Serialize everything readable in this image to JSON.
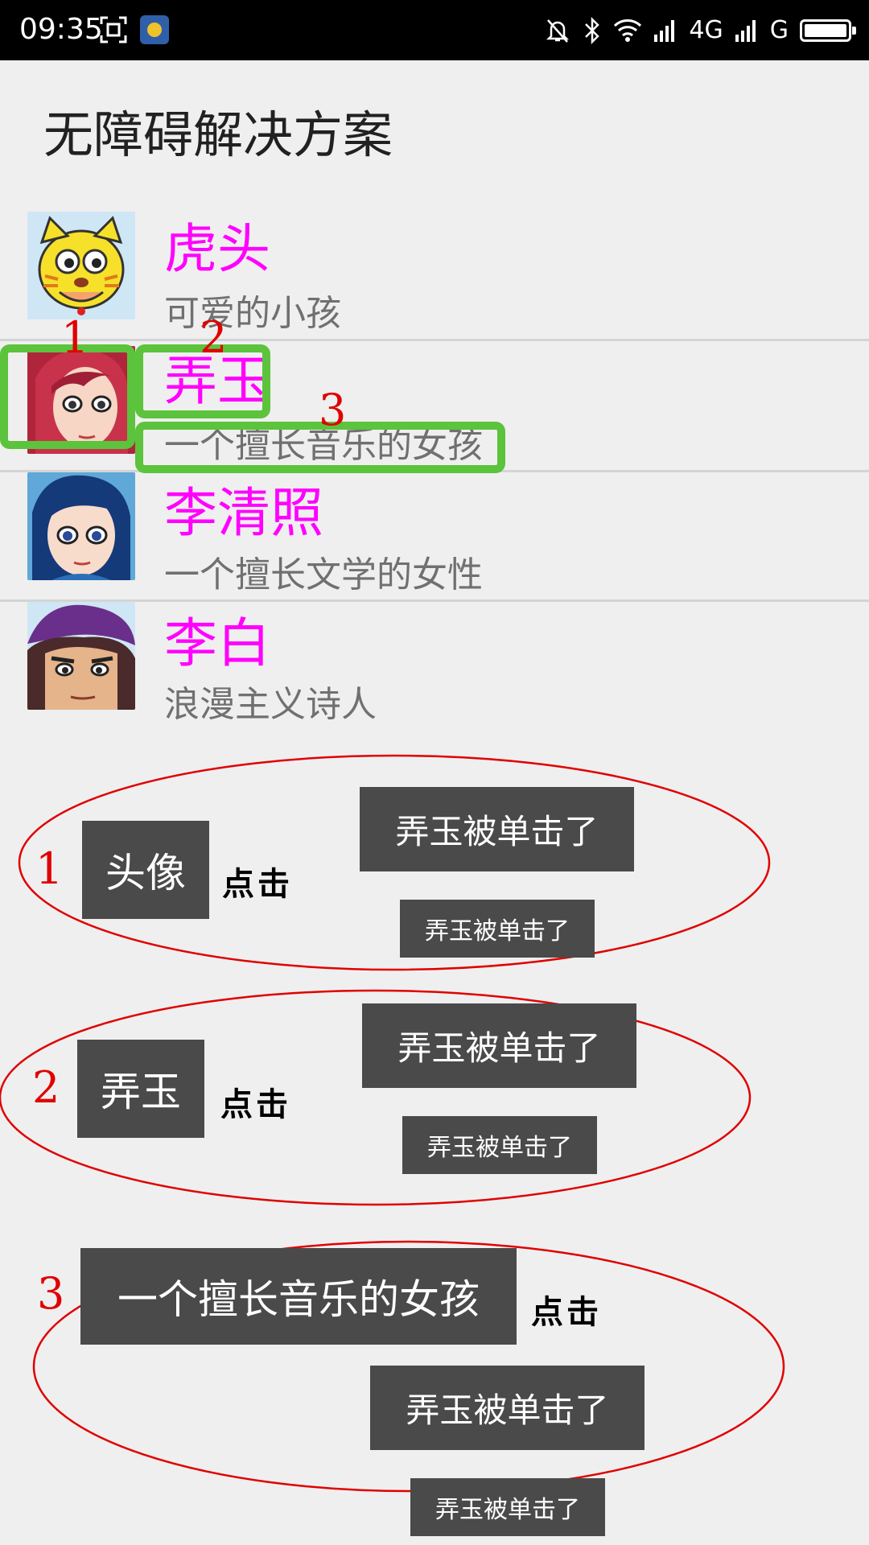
{
  "status_bar": {
    "time": "09:35",
    "network_4g": "4G",
    "network_g": "G",
    "icons": [
      "screenshot-icon",
      "app-icon",
      "mute-bell-icon",
      "bluetooth-icon",
      "wifi-icon",
      "signal-icon",
      "signal-icon",
      "battery-icon"
    ]
  },
  "page": {
    "title": "无障碍解决方案"
  },
  "list": [
    {
      "name": "虎头",
      "desc": "可爱的小孩",
      "avatar": "tiger-avatar"
    },
    {
      "name": "弄玉",
      "desc": "一个擅长音乐的女孩",
      "avatar": "nongyu-avatar"
    },
    {
      "name": "李清照",
      "desc": "一个擅长文学的女性",
      "avatar": "liqingzhao-avatar"
    },
    {
      "name": "李白",
      "desc": "浪漫主义诗人",
      "avatar": "libai-avatar"
    }
  ],
  "annotations": {
    "numbers": [
      "1",
      "2",
      "3"
    ],
    "click_label": "点击",
    "groups": [
      {
        "num": "1",
        "target": "头像",
        "toast_large": "弄玉被单击了",
        "toast_small": "弄玉被单击了"
      },
      {
        "num": "2",
        "target": "弄玉",
        "toast_large": "弄玉被单击了",
        "toast_small": "弄玉被单击了"
      },
      {
        "num": "3",
        "target": "一个擅长音乐的女孩",
        "toast_large": "弄玉被单击了",
        "toast_small": "弄玉被单击了"
      }
    ]
  },
  "colors": {
    "name": "#ff00ff",
    "desc": "#707070",
    "highlight_box": "#5cc33c",
    "annotation_red": "#e00000",
    "toast_bg": "#4a4a4a"
  }
}
